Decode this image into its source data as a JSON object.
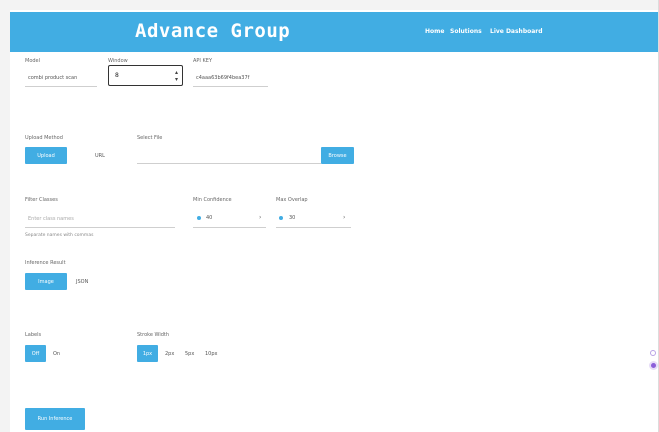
{
  "header": {
    "title": "Advance Group",
    "nav": [
      "Home",
      "Solutions",
      "Live Dashboard"
    ]
  },
  "row1": {
    "model": {
      "label": "Model",
      "value": "combi product scan"
    },
    "window": {
      "label": "Window",
      "value": "8"
    },
    "api_key": {
      "label": "API KEY",
      "value": "c4aaa63b69f4bea37f"
    }
  },
  "row2": {
    "upload_method": {
      "label": "Upload Method",
      "options": [
        "Upload",
        "URL"
      ]
    },
    "select_file": {
      "label": "Select File",
      "button": "Browse"
    }
  },
  "row3": {
    "filter_classes": {
      "label": "Filter Classes",
      "placeholder": "Enter class names",
      "hint": "Separate names with commas"
    },
    "min_confidence": {
      "label": "Min Confidence",
      "value": "40"
    },
    "max_overlap": {
      "label": "Max Overlap",
      "value": "30"
    }
  },
  "row4": {
    "inference_result": {
      "label": "Inference Result",
      "options": [
        "Image",
        "JSON"
      ]
    }
  },
  "row5": {
    "labels": {
      "label": "Labels",
      "options": [
        "Off",
        "On"
      ]
    },
    "stroke_width": {
      "label": "Stroke Width",
      "options": [
        "1px",
        "2px",
        "5px",
        "10px"
      ]
    }
  },
  "actions": {
    "run_inference": "Run Inference"
  },
  "colors": {
    "accent": "#41ade3",
    "widget": "#8b5fd9"
  }
}
